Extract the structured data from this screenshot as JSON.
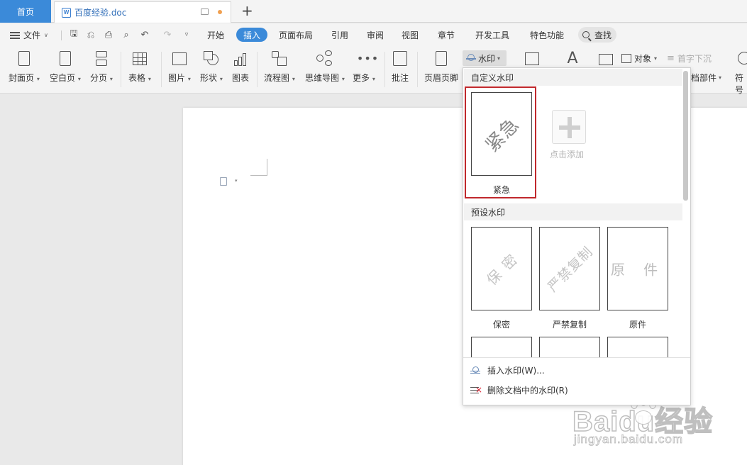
{
  "tabs": {
    "home": "首页",
    "doc_title": "百度经验.doc",
    "new_tab": "+"
  },
  "menu": {
    "file": "文件",
    "items": [
      "开始",
      "插入",
      "页面布局",
      "引用",
      "审阅",
      "视图",
      "章节",
      "开发工具",
      "特色功能"
    ],
    "active": "插入",
    "search": "查找"
  },
  "ribbon": {
    "cover": "封面页",
    "blank": "空白页",
    "page_break": "分页",
    "table": "表格",
    "picture": "图片",
    "shape": "形状",
    "chart": "图表",
    "flowchart": "流程图",
    "mindmap": "思维导图",
    "more": "更多",
    "comment": "批注",
    "header_footer": "页眉页脚",
    "watermark": "水印",
    "object": "对象",
    "drop_cap": "首字下沉",
    "doc_parts": "档部件",
    "symbol": "符号"
  },
  "watermark_panel": {
    "custom_heading": "自定义水印",
    "custom_items": [
      {
        "label": "紧急",
        "text": "紧急"
      }
    ],
    "add_label": "点击添加",
    "preset_heading": "预设水印",
    "preset_items": [
      {
        "label": "保密",
        "text": "保 密"
      },
      {
        "label": "严禁复制",
        "text": "严禁复制"
      },
      {
        "label": "原件",
        "text": "原 件"
      }
    ],
    "insert_action": "插入水印(W)...",
    "delete_action": "删除文档中的水印(R)"
  },
  "site_watermark": {
    "brand": "Baidu经验",
    "url": "jingyan.baidu.com"
  },
  "colors": {
    "accent": "#3b8ad9",
    "selection": "#c0282c"
  }
}
